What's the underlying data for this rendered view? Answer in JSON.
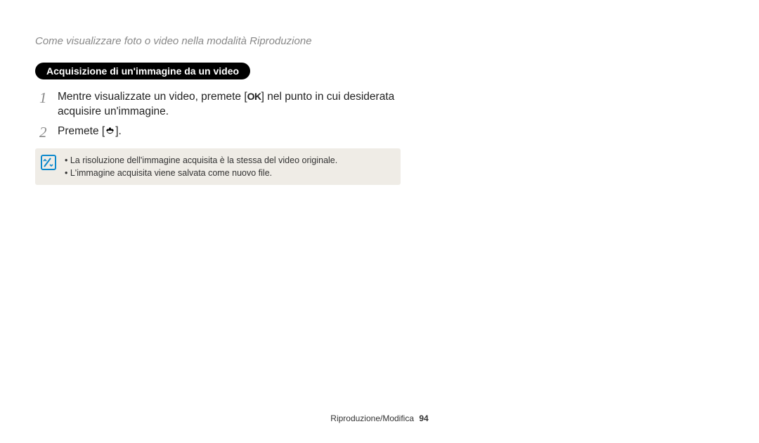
{
  "header": "Come visualizzare foto o video nella modalità Riproduzione",
  "section_title": "Acquisizione di un'immagine da un video",
  "steps": [
    {
      "num": "1",
      "pre": "Mentre visualizzate un video, premete [",
      "icon": "ok",
      "post": "] nel punto in cui desiderata acquisire un'immagine."
    },
    {
      "num": "2",
      "pre": "Premete [",
      "icon": "macro",
      "post": "]."
    }
  ],
  "notes": [
    "La risoluzione dell'immagine acquisita è la stessa del video originale.",
    "L'immagine acquisita viene salvata come nuovo file."
  ],
  "footer_section": "Riproduzione/Modifica",
  "footer_page": "94",
  "icons": {
    "ok": "OK"
  }
}
